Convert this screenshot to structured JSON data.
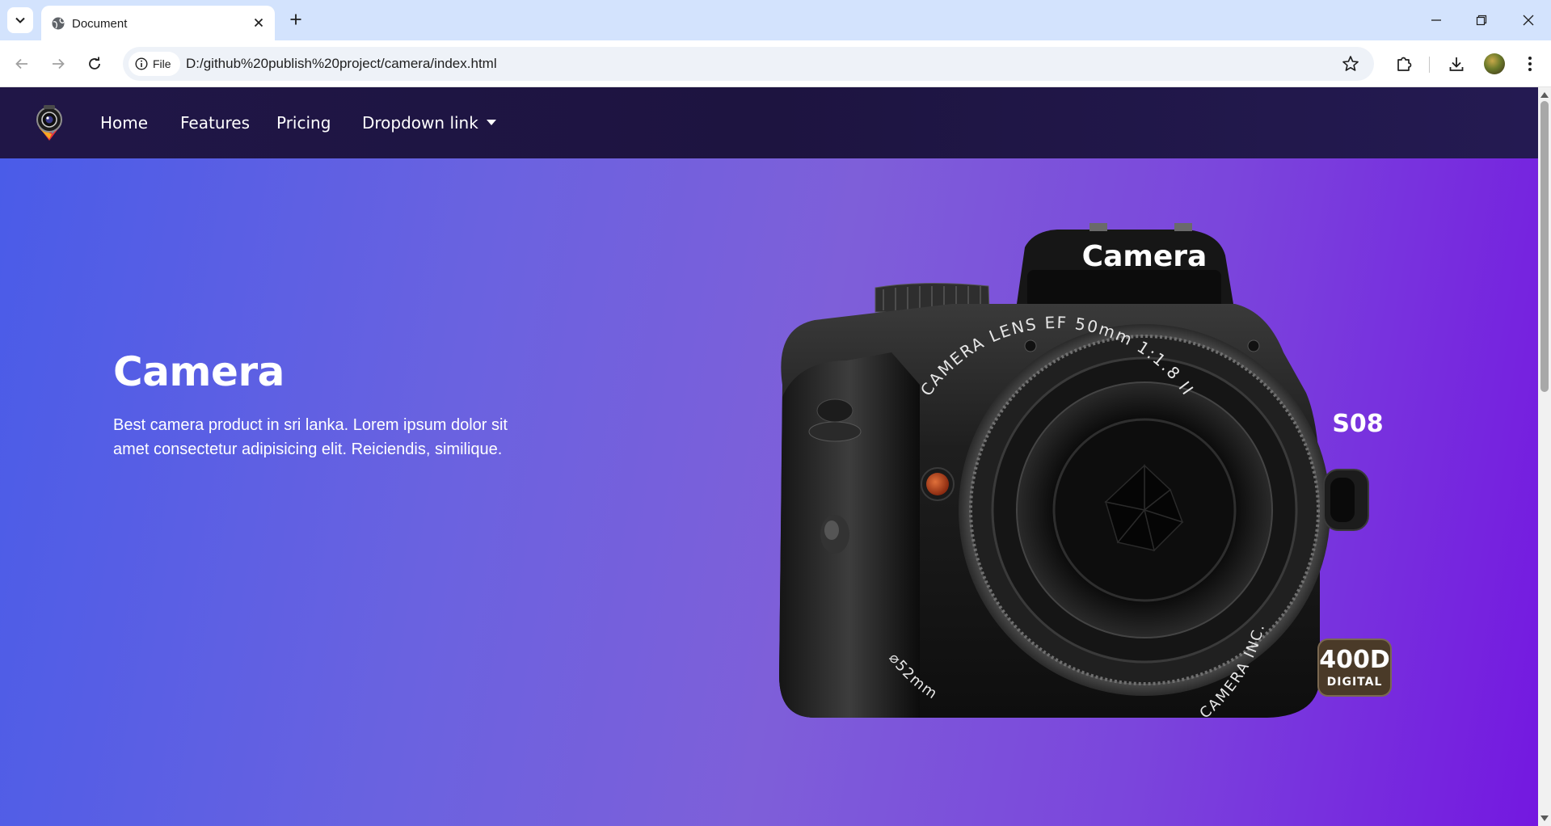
{
  "browser": {
    "tab_title": "Document",
    "site_chip_label": "File",
    "url": "D:/github%20publish%20project/camera/index.html"
  },
  "navbar": {
    "links": [
      {
        "label": "Home"
      },
      {
        "label": "Features"
      },
      {
        "label": "Pricing"
      },
      {
        "label": "Dropdown link"
      }
    ]
  },
  "hero": {
    "title": "Camera",
    "description": "Best camera product in sri lanka. Lorem ipsum dolor sit amet consectetur adipisicing elit. Reiciendis, similique."
  },
  "camera_image": {
    "brand_label": "Camera",
    "lens_ring_text": "CAMERA LENS EF 50mm 1:1.8 II",
    "lens_size_text": "⌀52mm",
    "lens_maker_text": "CAMERA INC.",
    "model_badge": "S08",
    "model_number": "400D",
    "model_sub": "DIGITAL"
  },
  "colors": {
    "tabstrip": "#d3e3fd",
    "navbar": "#201647",
    "hero_start": "#4a5ce8",
    "hero_end": "#7418e0"
  }
}
